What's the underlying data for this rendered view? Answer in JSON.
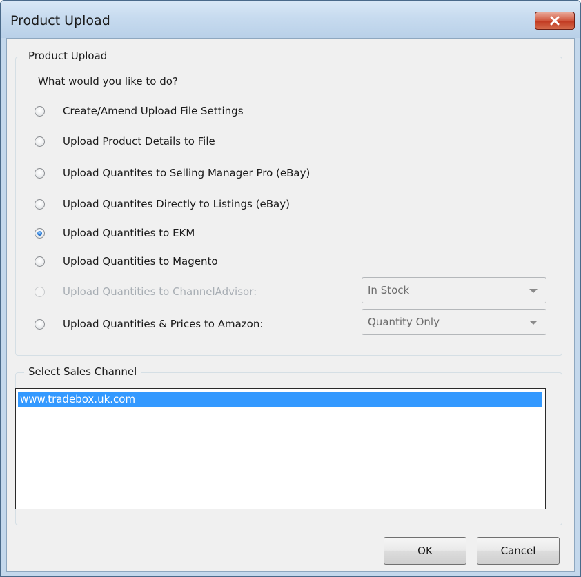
{
  "window": {
    "title": "Product Upload"
  },
  "upload_group": {
    "legend": "Product Upload",
    "prompt": "What would you like to do?",
    "options": [
      {
        "label": "Create/Amend Upload File Settings",
        "checked": false,
        "enabled": true
      },
      {
        "label": "Upload Product Details to File",
        "checked": false,
        "enabled": true
      },
      {
        "label": "Upload Quantites to Selling Manager Pro (eBay)",
        "checked": false,
        "enabled": true
      },
      {
        "label": "Upload Quantites Directly to Listings (eBay)",
        "checked": false,
        "enabled": true
      },
      {
        "label": "Upload Quantities to EKM",
        "checked": true,
        "enabled": true
      },
      {
        "label": "Upload Quantities to Magento",
        "checked": false,
        "enabled": true
      },
      {
        "label": "Upload Quantities to ChannelAdvisor:",
        "checked": false,
        "enabled": false
      },
      {
        "label": "Upload Quantities & Prices to Amazon:",
        "checked": false,
        "enabled": true
      }
    ],
    "channeladvisor_select": "In Stock",
    "amazon_select": "Quantity Only"
  },
  "sales_channel_group": {
    "legend": "Select Sales Channel",
    "items": [
      "www.tradebox.uk.com"
    ],
    "selected_index": 0
  },
  "buttons": {
    "ok": "OK",
    "cancel": "Cancel"
  },
  "colors": {
    "selection": "#3399ff",
    "close_button": "#c8452b",
    "title_bar": "#c7dbef"
  }
}
